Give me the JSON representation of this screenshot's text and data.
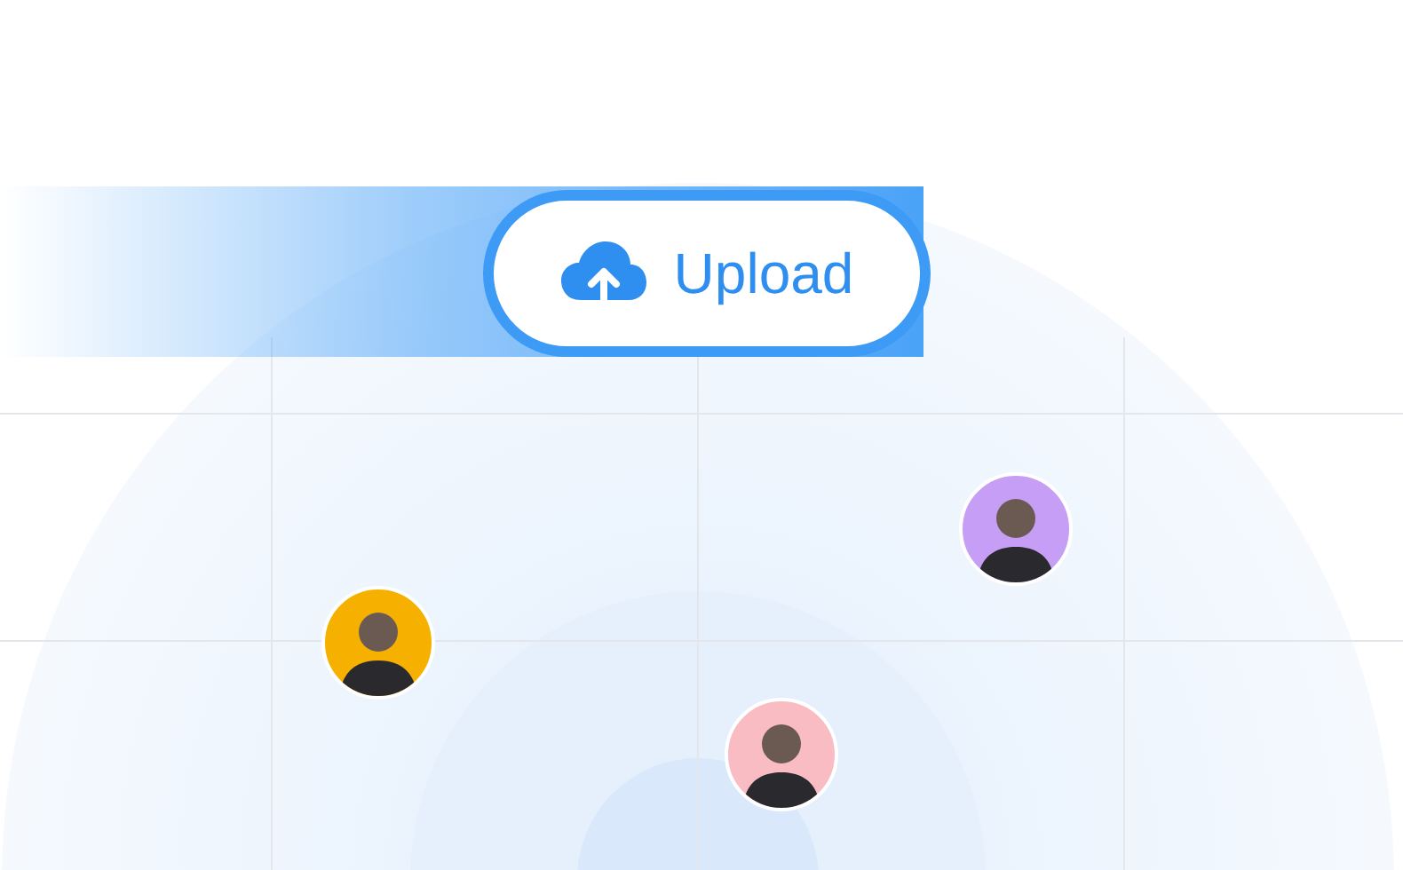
{
  "upload_button": {
    "label": "Upload"
  },
  "avatars": [
    {
      "color": "#f6b100"
    },
    {
      "color": "#c79ef6"
    },
    {
      "color": "#f9bcc3"
    }
  ]
}
